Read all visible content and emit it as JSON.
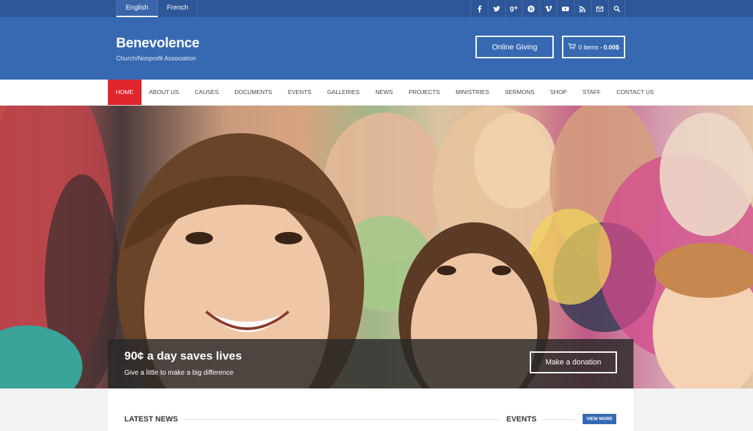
{
  "topbar": {
    "languages": [
      {
        "label": "English",
        "active": true
      },
      {
        "label": "French",
        "active": false
      }
    ],
    "social_icons": [
      "facebook-icon",
      "twitter-icon",
      "google-plus-icon",
      "pinterest-icon",
      "vimeo-icon",
      "youtube-icon",
      "rss-icon",
      "email-icon",
      "search-icon"
    ],
    "google_plus_glyph": "g+"
  },
  "header": {
    "title": "Benevolence",
    "tagline": "Church/Nonprofit Association",
    "online_giving_label": "Online Giving",
    "cart": {
      "items_label": "0 items -",
      "amount": "0.00$"
    }
  },
  "nav": {
    "items": [
      "HOME",
      "ABOUT US",
      "CAUSES",
      "DOCUMENTS",
      "EVENTS",
      "GALLERIES",
      "NEWS",
      "PROJECTS",
      "MINISTRIES",
      "SERMONS",
      "SHOP",
      "STAFF",
      "CONTACT US"
    ],
    "active_index": 0
  },
  "hero": {
    "title": "90¢ a day saves lives",
    "subtitle": "Give a little to make a big difference",
    "donate_label": "Make a donation"
  },
  "sections": {
    "latest_news": "LATEST NEWS",
    "events": "EVENTS",
    "view_more": "VIEW MORE"
  },
  "colors": {
    "topbar": "#2d5799",
    "header": "#3769b2",
    "nav_active": "#e0262d"
  }
}
